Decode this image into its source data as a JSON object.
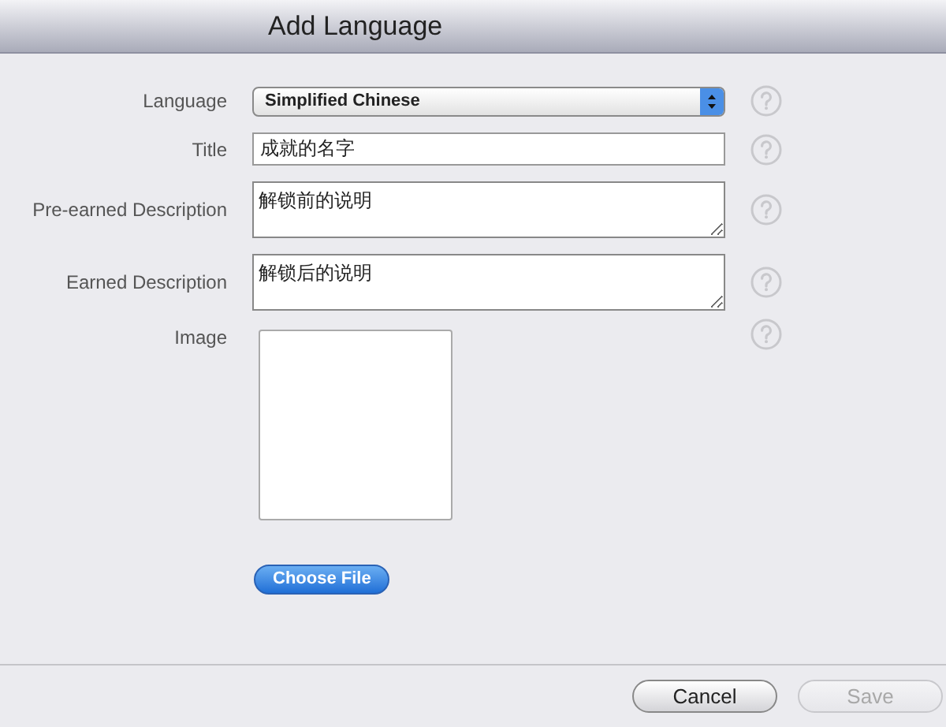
{
  "window": {
    "title": "Add Language"
  },
  "fields": [
    {
      "kind": "select",
      "label": "Language",
      "value": "Simplified Chinese"
    },
    {
      "kind": "text",
      "label": "Title",
      "value": "成就的名字"
    },
    {
      "kind": "textarea",
      "label": "Pre-earned Description",
      "value": "解锁前的说明"
    },
    {
      "kind": "textarea",
      "label": "Earned Description",
      "value": "解锁后的说明"
    },
    {
      "kind": "image",
      "label": "Image",
      "button": "Choose File"
    }
  ],
  "buttons": [
    {
      "label": "Cancel",
      "disabled": false
    },
    {
      "label": "Save",
      "disabled": true
    }
  ]
}
